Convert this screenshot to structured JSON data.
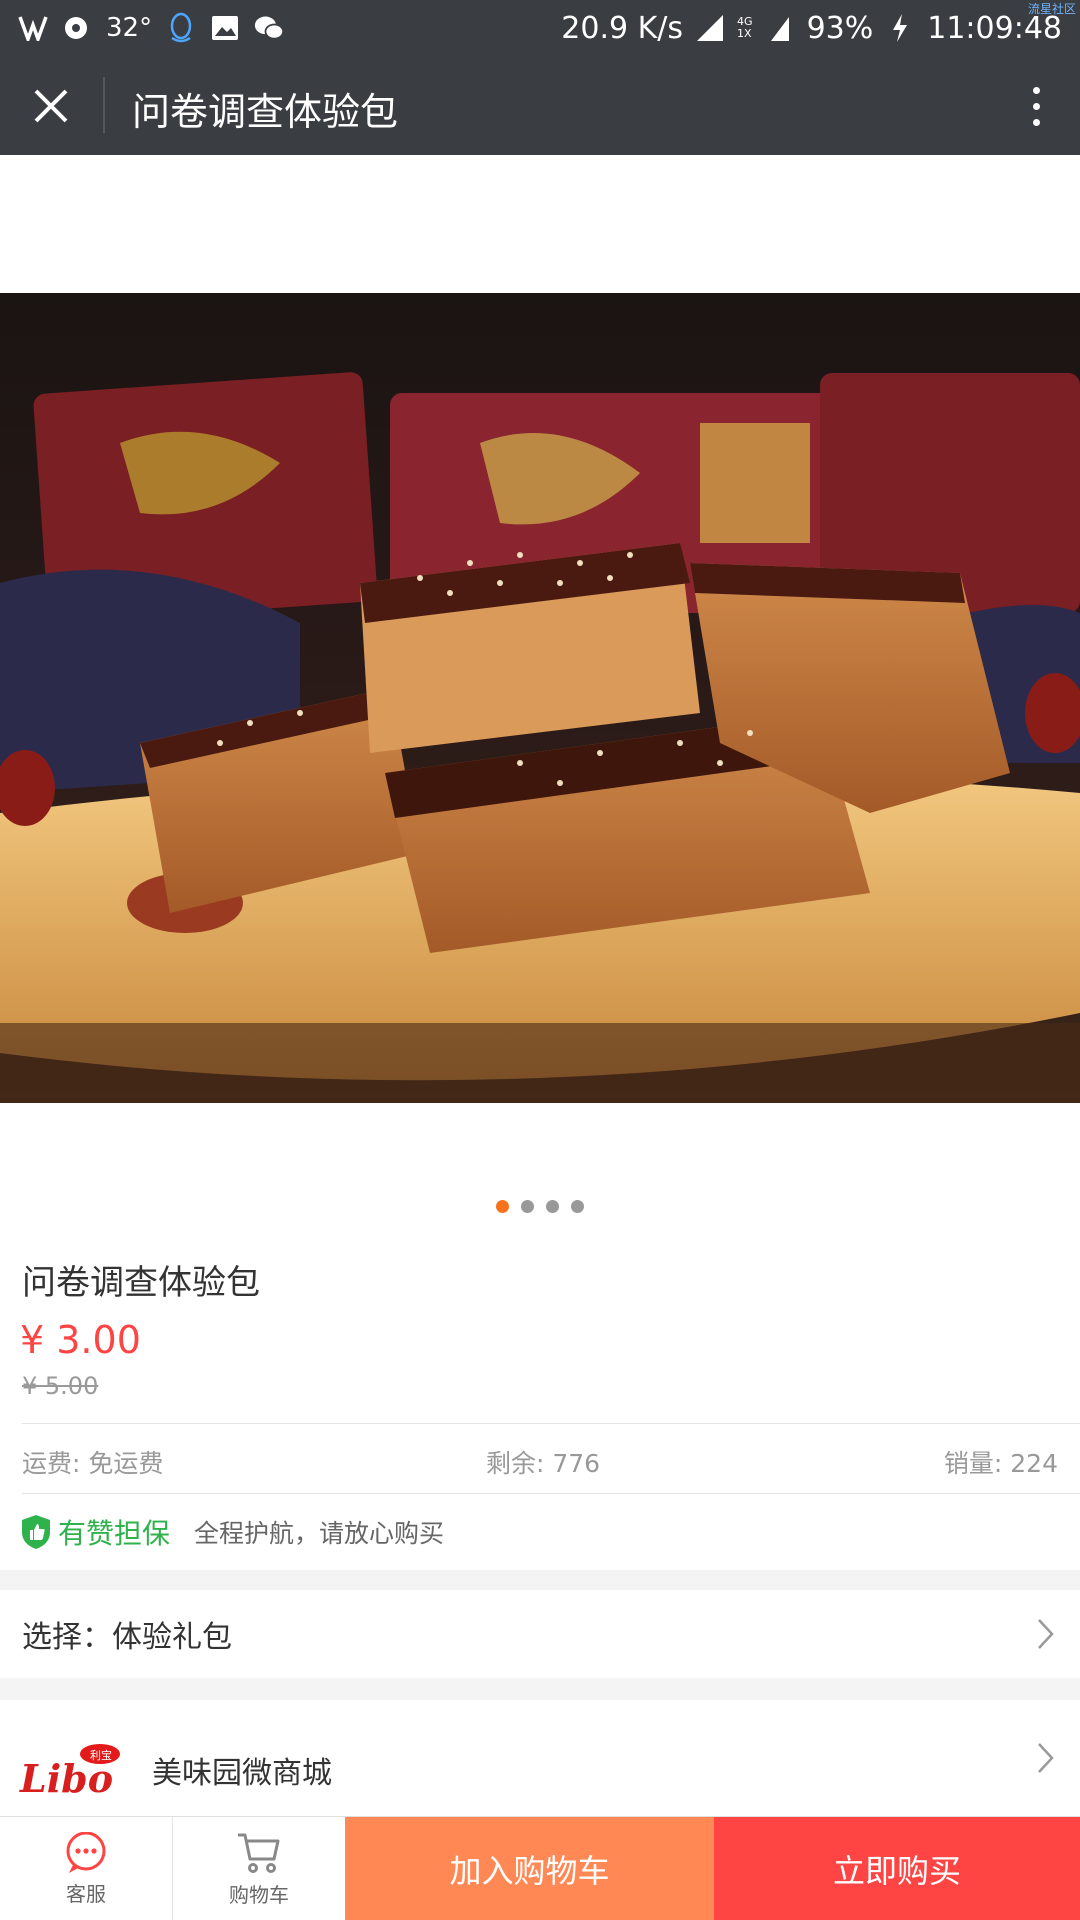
{
  "status_bar": {
    "temperature": "32°",
    "network_speed": "20.9 K/s",
    "network_type_top": "4G",
    "network_type_bottom": "1X",
    "battery": "93%",
    "time": "11:09:48",
    "watermark": "流星社区",
    "left_icons": [
      "app-icon",
      "record-icon",
      "qq-icon",
      "gallery-icon",
      "wechat-icon"
    ]
  },
  "title_bar": {
    "title": "问卷调查体验包"
  },
  "gallery": {
    "image_alt": "product-photo-brown-sugar-cakes",
    "dot_count": 4,
    "active_dot": 0
  },
  "product": {
    "title": "问卷调查体验包",
    "price": "¥ 3.00",
    "original_price": "¥ 5.00",
    "shipping": "运费: 免运费",
    "stock": "剩余: 776",
    "sales": "销量: 224"
  },
  "guarantee": {
    "brand": "有赞担保",
    "text": "全程护航，请放心购买"
  },
  "selection": {
    "label": "选择：体验礼包"
  },
  "shop": {
    "logo_text": "Libo",
    "logo_badge": "利宝",
    "name": "美味园微商城"
  },
  "bottom_bar": {
    "service_label": "客服",
    "cart_label": "购物车",
    "add_to_cart": "加入购物车",
    "buy_now": "立即购买"
  },
  "colors": {
    "header_bg": "#3a3d42",
    "price_red": "#ff4444",
    "active_dot": "#f7731b",
    "guarantee_green": "#2fb14b",
    "cart_button": "#ff8855",
    "buy_button": "#ff4444",
    "service_icon": "#ff4444"
  }
}
